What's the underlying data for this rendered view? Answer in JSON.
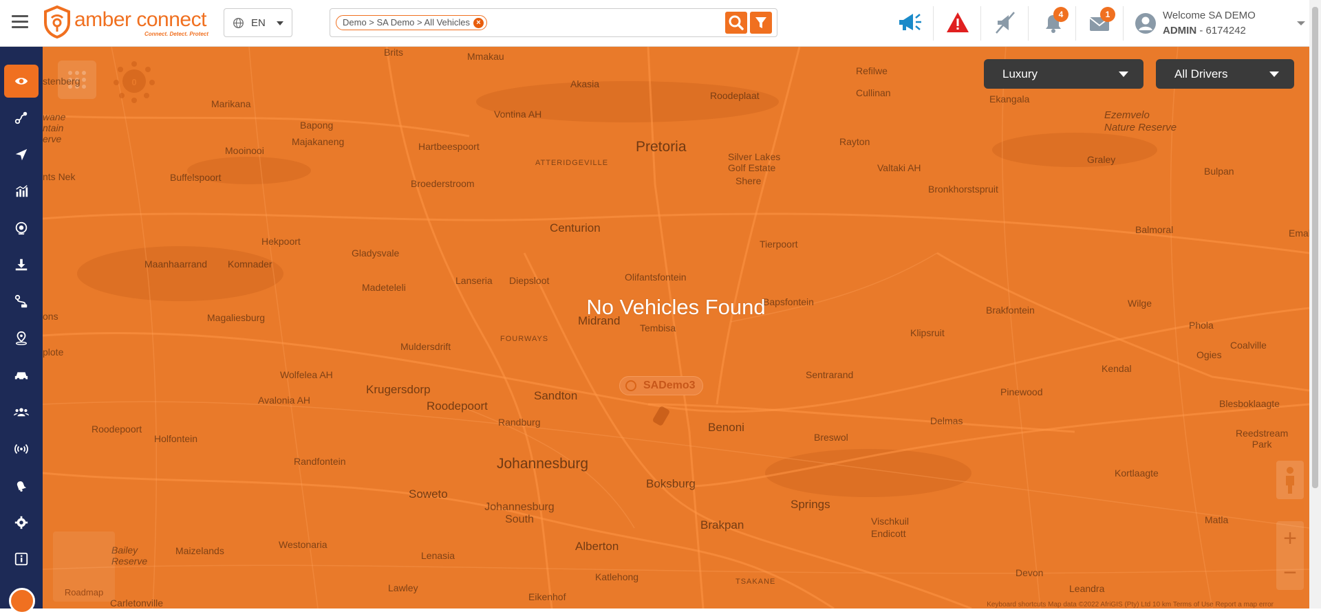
{
  "header": {
    "menu_icon": "hamburger-icon",
    "logo_text": "amber connect",
    "logo_tagline": "Connect. Detect. Protect",
    "language": "EN",
    "search_chip": "Demo > SA Demo > All Vehicles",
    "notifications_count": "4",
    "messages_count": "1",
    "welcome_text": "Welcome SA DEMO",
    "role": "ADMIN",
    "account_suffix": " - 6174242"
  },
  "sidebar": {
    "items": [
      {
        "icon": "eye-icon"
      },
      {
        "icon": "route-icon"
      },
      {
        "icon": "navigation-icon"
      },
      {
        "icon": "chart-icon"
      },
      {
        "icon": "camera-icon"
      },
      {
        "icon": "download-icon"
      },
      {
        "icon": "trip-icon"
      },
      {
        "icon": "location-pin-icon"
      },
      {
        "icon": "car-icon"
      },
      {
        "icon": "users-icon"
      },
      {
        "icon": "signal-icon"
      },
      {
        "icon": "notify-icon"
      },
      {
        "icon": "settings-icon"
      },
      {
        "icon": "info-icon"
      }
    ]
  },
  "map": {
    "message": "No Vehicles Found",
    "vehicle_label": "SADemo3",
    "filter_category": "Luxury",
    "filter_drivers": "All Drivers",
    "cluster_count": "0",
    "roadmap_label": "Roadmap",
    "zoom_in": "+",
    "zoom_out": "−",
    "attribution": "Keyboard shortcuts   Map data ©2022 AfriGIS (Pty) Ltd   10 km        Terms of Use   Report a map error",
    "towns": {
      "pretoria": "Pretoria",
      "centurion": "Centurion",
      "midrand": "Midrand",
      "sandton": "Sandton",
      "johannesburg": "Johannesburg",
      "johannesburg_south": "Johannesburg South",
      "soweto": "Soweto",
      "roodepoort": "Roodepoort",
      "krugersdorp": "Krugersdorp",
      "boksburg": "Boksburg",
      "benoni": "Benoni",
      "springs": "Springs",
      "brakpan": "Brakpan",
      "alberton": "Alberton",
      "tembisa": "Tembisa",
      "olifantsfontein": "Olifantsfontein",
      "diepsloot": "Diepsloot",
      "lanseria": "Lanseria",
      "fourways": "FOURWAYS",
      "randburg": "Randburg",
      "muldersdrift": "Muldersdrift",
      "randfontein": "Randfontein",
      "westonaria": "Westonaria",
      "lenasia": "Lenasia",
      "lawley": "Lawley",
      "katlehong": "Katlehong",
      "tsakane": "TSAKANE",
      "eikenhof": "Eikenhof",
      "akasia": "Akasia",
      "mmakau": "Mmakau",
      "brits": "Brits",
      "marikana": "Marikana",
      "bapong": "Bapong",
      "majakaneng": "Majakaneng",
      "mooinooi": "Mooinooi",
      "buffelspoort": "Buffelspoort",
      "hartbeespoort": "Hartbeespoort",
      "broederstroom": "Broederstroom",
      "atteridgeville": "ATTERIDGEVILLE",
      "vontina": "Vontina AH",
      "roodeplaat": "Roodeplaat",
      "refilwe": "Refilwe",
      "cullinan": "Cullinan",
      "ekangala": "Ekangala",
      "rayton": "Rayton",
      "silver_lakes": "Silver Lakes\nGolf Estate",
      "shere": "Shere",
      "valtaki": "Valtaki AH",
      "bronkhorstspruit": "Bronkhorstspruit",
      "graley": "Graley",
      "bulpan": "Bulpan",
      "balmoral": "Balmoral",
      "emal": "Emal",
      "ezemvelo": "Ezemvelo\nNature Reserve",
      "tierpoort": "Tierpoort",
      "hekpoort": "Hekpoort",
      "gladysvale": "Gladysvale",
      "maanhaarrand": "Maanhaarrand",
      "komnader": "Komnader",
      "magaliesburg": "Magaliesburg",
      "madeteleli": "Madeteleli",
      "wolfelea": "Wolfelea AH",
      "avalonia": "Avalonia AH",
      "holfontein": "Holfontein",
      "roodepoort_w": "Roodepoort",
      "maizelands": "Maizelands",
      "bapsfontein": "Bapsfontein",
      "klipsruit": "Klipsruit",
      "brakfontein": "Brakfontein",
      "wilge": "Wilge",
      "phola": "Phola",
      "ogies": "Ogies",
      "coalville": "Coalville",
      "kendal": "Kendal",
      "sentrarand": "Sentrarand",
      "pinewood": "Pinewood",
      "delmas": "Delmas",
      "breswol": "Breswol",
      "blesboklaagte": "Blesboklaagte",
      "reedstream": "Reedstream\nPark",
      "kortlaagte": "Kortlaagte",
      "vischkuil": "Vischkuil",
      "endicott": "Endicott",
      "devon": "Devon",
      "matla": "Matla",
      "leandra": "Leandra",
      "carletonville": "Carletonville",
      "bailey": "Bailey\nReserve",
      "ts_nek": "nts Nek",
      "stenberg": "stenberg",
      "swane": "wane\nntain\nerve",
      "ons": "ons",
      "plote": "plote"
    }
  }
}
